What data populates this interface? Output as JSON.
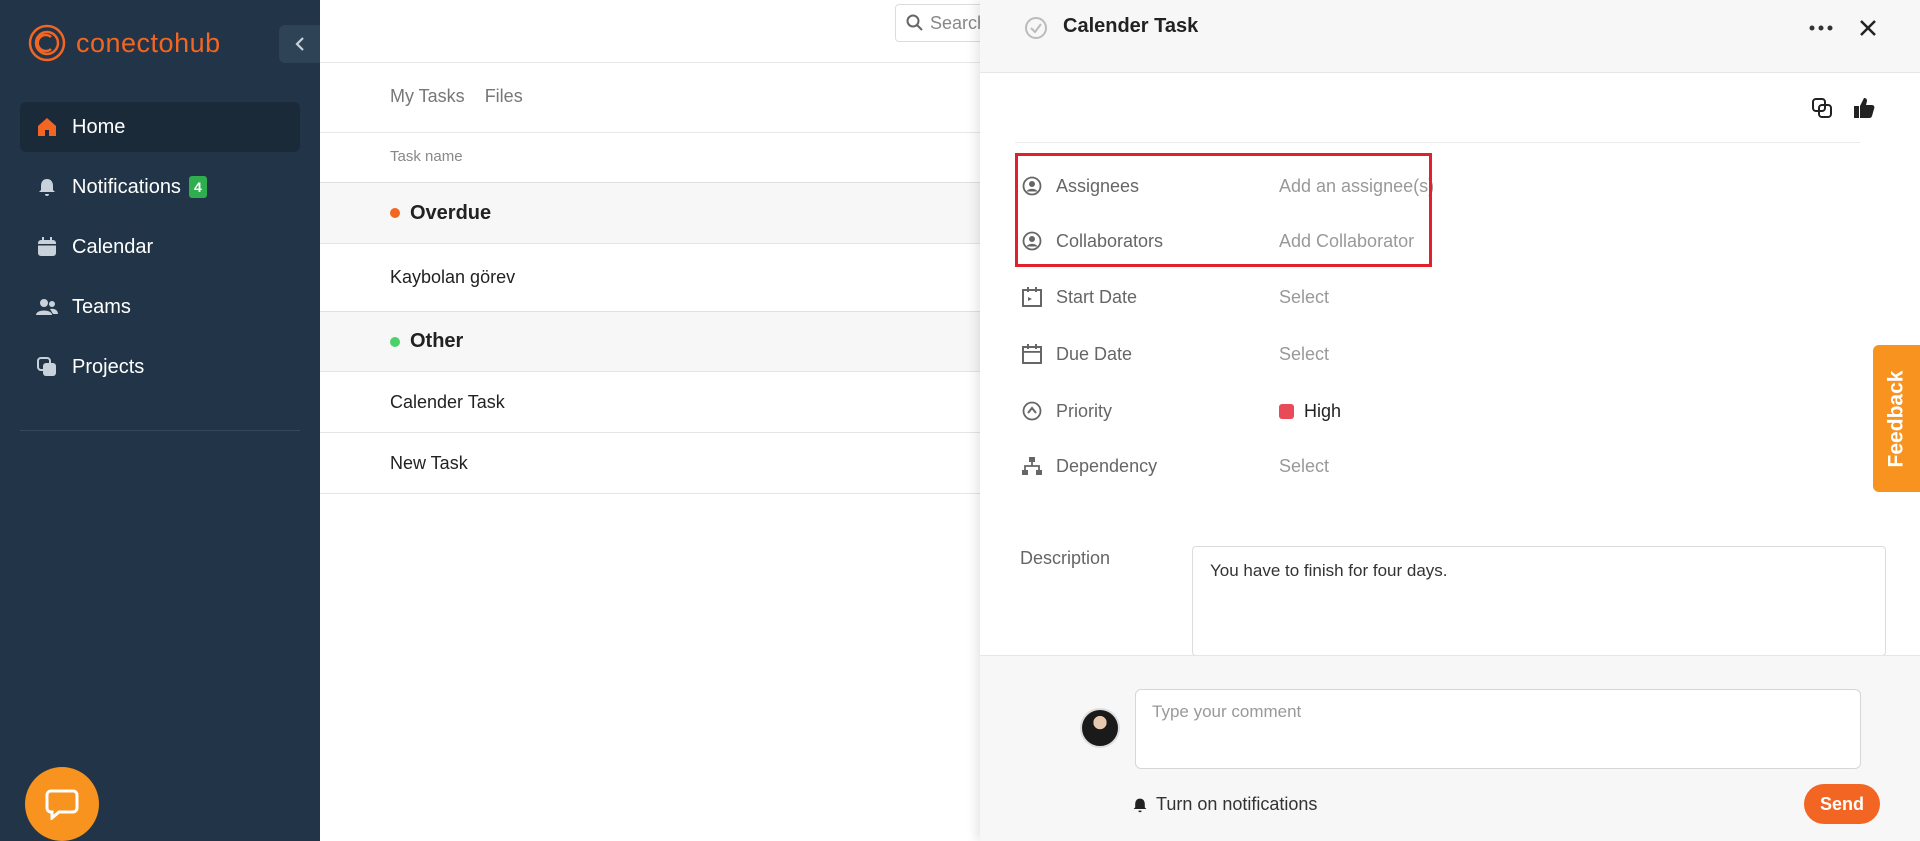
{
  "app": {
    "brand": "conectohub",
    "brand_color": "#f26522",
    "sidebar_bg": "#223447"
  },
  "sidebar": {
    "items": [
      {
        "label": "Home",
        "icon": "home-icon",
        "active": true
      },
      {
        "label": "Notifications",
        "icon": "bell-icon",
        "badge": "4"
      },
      {
        "label": "Calendar",
        "icon": "calendar-icon"
      },
      {
        "label": "Teams",
        "icon": "users-icon"
      },
      {
        "label": "Projects",
        "icon": "projects-icon"
      }
    ]
  },
  "main": {
    "search_placeholder": "Search",
    "tabs": [
      "My Tasks",
      "Files"
    ],
    "column_header": "Task name",
    "groups": [
      {
        "label": "Overdue",
        "color": "#f26522",
        "tasks": [
          "Kaybolan görev"
        ]
      },
      {
        "label": "Other",
        "color": "#4cd06a",
        "tasks": [
          "Calender Task",
          "New Task"
        ]
      }
    ]
  },
  "drawer": {
    "title": "Calender Task",
    "fields": [
      {
        "label": "Assignees",
        "value": "Add an assignee(s)",
        "icon": "user-circle-icon"
      },
      {
        "label": "Collaborators",
        "value": "Add Collaborator",
        "icon": "user-circle-icon"
      },
      {
        "label": "Start Date",
        "value": "Select",
        "icon": "calendar-start-icon"
      },
      {
        "label": "Due Date",
        "value": "Select",
        "icon": "calendar-icon"
      },
      {
        "label": "Priority",
        "value": "High",
        "icon": "priority-icon",
        "priority_color": "#e94a57"
      },
      {
        "label": "Dependency",
        "value": "Select",
        "icon": "dependency-icon"
      }
    ],
    "description_label": "Description",
    "description": "You have to finish for four days.",
    "comment_placeholder": "Type your comment",
    "notify_label": "Turn on notifications",
    "send_label": "Send"
  },
  "feedback_label": "Feedback"
}
